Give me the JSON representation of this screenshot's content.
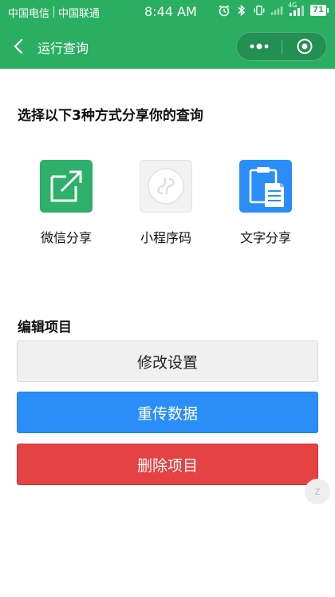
{
  "status_bar": {
    "carrier_1": "中国电信",
    "carrier_2": "中国联通",
    "time": "8:44 AM",
    "network": "4G",
    "battery": "71",
    "icons": [
      "alarm-icon",
      "bluetooth-icon",
      "vibrate-icon",
      "signal-icon",
      "wifi-signal-icon",
      "battery-icon"
    ]
  },
  "nav": {
    "title": "运行查询",
    "back_icon": "back-chevron-icon",
    "menu_icon": "more-dots-icon",
    "close_icon": "target-circle-icon"
  },
  "share": {
    "heading": "选择以下3种方式分享你的查询",
    "options": [
      {
        "label": "微信分享",
        "icon": "share-out-icon",
        "color": "#2eaf6a"
      },
      {
        "label": "小程序码",
        "icon": "miniprogram-code-icon",
        "color": "#f2f2f2"
      },
      {
        "label": "文字分享",
        "icon": "clipboard-document-icon",
        "color": "#2b8ef8"
      }
    ]
  },
  "edit": {
    "heading": "编辑项目",
    "modify_label": "修改设置",
    "reupload_label": "重传数据",
    "delete_label": "删除项目"
  },
  "float_button": {
    "label": "z"
  },
  "colors": {
    "brand_green": "#2aaf62",
    "primary_blue": "#2b8ef8",
    "danger_red": "#e54243"
  }
}
